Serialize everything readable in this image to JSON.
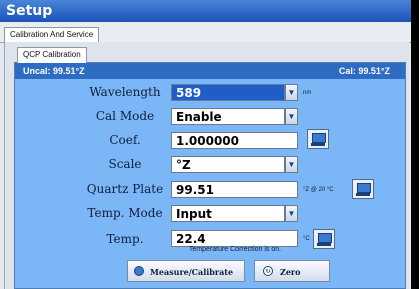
{
  "window": {
    "title": "Setup"
  },
  "tabs": {
    "outer": "Calibration And Service",
    "inner": "QCP Calibration"
  },
  "status": {
    "uncal": "Uncal:  99.51°Z",
    "cal": "Cal:  99.51°Z"
  },
  "fields": {
    "wavelength": {
      "label": "Wavelength",
      "value": "589",
      "unit": "nm"
    },
    "cal_mode": {
      "label": "Cal Mode",
      "value": "Enable"
    },
    "coef": {
      "label": "Coef.",
      "value": "1.000000"
    },
    "scale": {
      "label": "Scale",
      "value": "°Z"
    },
    "quartz_plate": {
      "label": "Quartz Plate",
      "value": "99.51",
      "unit": "°Z @ 20 °C"
    },
    "temp_mode": {
      "label": "Temp. Mode",
      "value": "Input"
    },
    "temp": {
      "label": "Temp.",
      "value": "22.4",
      "unit": "°C"
    }
  },
  "note": "Temperature Correction is on.",
  "buttons": {
    "measure": "Measure/Calibrate",
    "zero": "Zero"
  },
  "icons": {
    "dropdown": "chevron-down-icon",
    "calibrate": "monitor-keypad-icon",
    "measure": "measure-icon",
    "zero": "zero-icon"
  }
}
